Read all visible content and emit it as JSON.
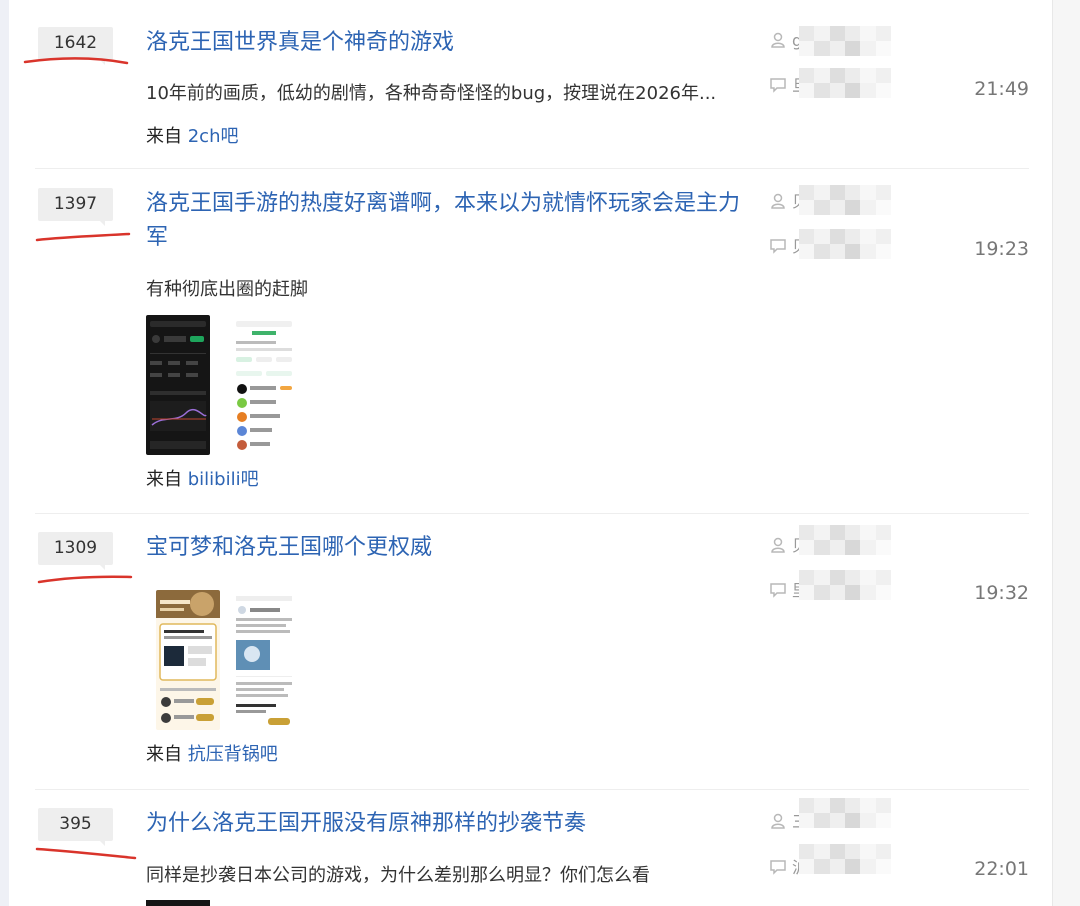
{
  "threads": [
    {
      "reply_count": "1642",
      "title": "洛克王国世界真是个神奇的游戏",
      "abstract": "10年前的画质，低幼的剧情，各种奇奇怪怪的bug，按理说在2026年...",
      "source_prefix": "来自",
      "forum": "2ch吧",
      "author_fragment": "g",
      "last_reply_fragment": "旦",
      "time": "21:49"
    },
    {
      "reply_count": "1397",
      "title": "洛克王国手游的热度好离谱啊，本来以为就情怀玩家会是主力军",
      "abstract": "有种彻底出圈的赶脚",
      "source_prefix": "来自",
      "forum": "bilibili吧",
      "author_fragment": "贝",
      "last_reply_fragment": "贝",
      "time": "19:23"
    },
    {
      "reply_count": "1309",
      "title": "宝可梦和洛克王国哪个更权威",
      "source_prefix": "来自",
      "forum": "抗压背锅吧",
      "author_fragment": "贝",
      "last_reply_fragment": "里",
      "time": "19:32"
    },
    {
      "reply_count": "395",
      "title": "为什么洛克王国开服没有原神那样的抄袭节奏",
      "abstract": "同样是抄袭日本公司的游戏，为什么差别那么明显？你们怎么看",
      "author_fragment": "三",
      "last_reply_fragment": "沪",
      "time": "22:01"
    }
  ],
  "colors": {
    "link": "#2d64b3",
    "annotation_red": "#d9342b",
    "badge_bg": "#eeeeee",
    "meta_gray": "#999999"
  },
  "icons": {
    "author": "user-icon",
    "last_reply": "comment-icon"
  }
}
